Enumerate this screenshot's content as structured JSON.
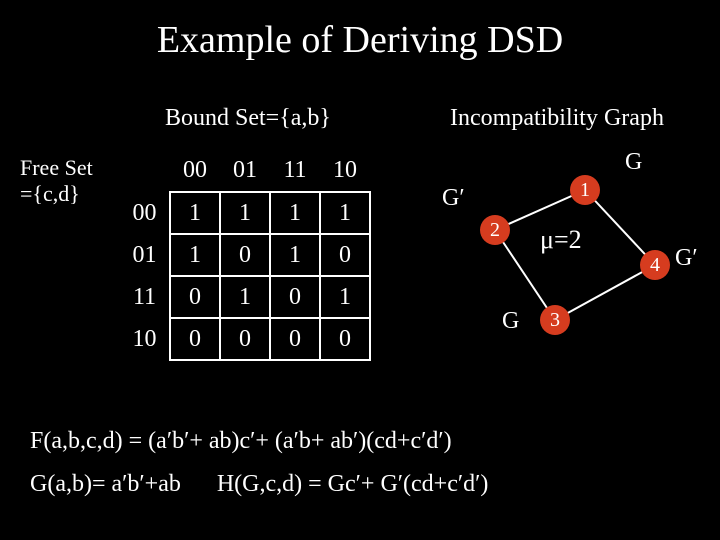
{
  "title": "Example of Deriving DSD",
  "boundSetLabel": "Bound Set={a,b}",
  "incompatLabel": "Incompatibility Graph",
  "freeSetLabel1": "Free Set",
  "freeSetLabel2": "={c,d}",
  "table": {
    "colHeaders": [
      "00",
      "01",
      "11",
      "10"
    ],
    "rowHeaders": [
      "00",
      "01",
      "11",
      "10"
    ],
    "rows": [
      [
        "1",
        "1",
        "1",
        "1"
      ],
      [
        "1",
        "0",
        "1",
        "0"
      ],
      [
        "0",
        "1",
        "0",
        "1"
      ],
      [
        "0",
        "0",
        "0",
        "0"
      ]
    ]
  },
  "graph": {
    "nodes": {
      "n1": "1",
      "n2": "2",
      "n3": "3",
      "n4": "4"
    },
    "edgeLabels": {
      "top": "G",
      "left": "G′",
      "right": "G′",
      "bottom": "G"
    },
    "mu": "μ=2"
  },
  "equations": {
    "line1": "F(a,b,c,d) = (a′b′+ ab)c′+ (a′b+ ab′)(cd+c′d′)",
    "line2a": "G(a,b)= a′b′+ab",
    "line2b": "H(G,c,d) = Gc′+ G′(cd+c′d′)"
  }
}
